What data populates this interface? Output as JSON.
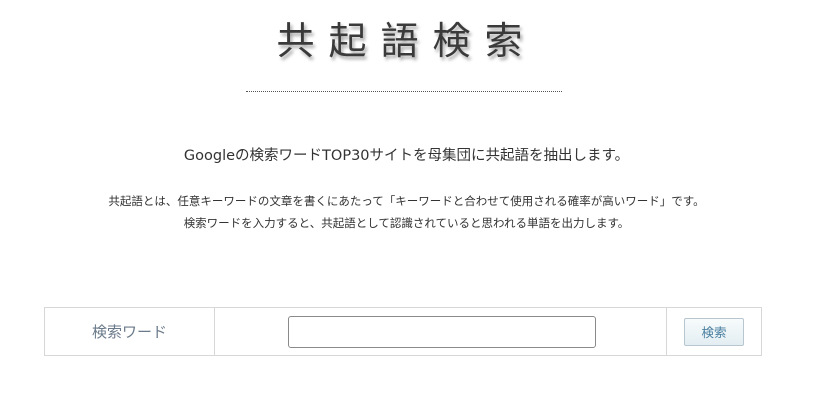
{
  "header": {
    "logo_text": "共起語検索"
  },
  "intro": {
    "lead": "Googleの検索ワードTOP30サイトを母集団に共起語を抽出します。",
    "description_line1": "共起語とは、任意キーワードの文章を書くにあたって「キーワードと合わせて使用される確率が高いワード」です。",
    "description_line2": "検索ワードを入力すると、共起語として認識されていると思われる単語を出力します。"
  },
  "search": {
    "label": "検索ワード",
    "input_value": "",
    "input_placeholder": "",
    "button_label": "検索"
  },
  "colors": {
    "label_text": "#6b7a8a",
    "button_text": "#4a7fa0",
    "border": "#d7d7d7"
  }
}
